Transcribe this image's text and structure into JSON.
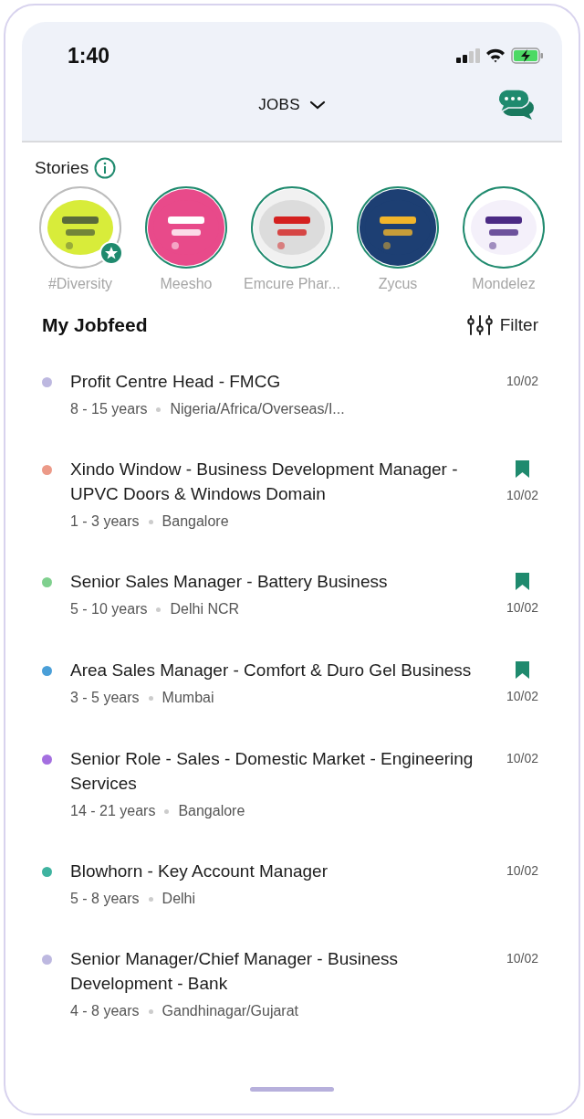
{
  "status_bar": {
    "time": "1:40"
  },
  "header": {
    "title": "JOBS"
  },
  "stories": {
    "title": "Stories",
    "items": [
      {
        "label": "#Diversity",
        "viewed": true,
        "featured": true
      },
      {
        "label": "Meesho",
        "viewed": false,
        "featured": false
      },
      {
        "label": "Emcure Phar...",
        "viewed": false,
        "featured": false
      },
      {
        "label": "Zycus",
        "viewed": false,
        "featured": false
      },
      {
        "label": "Mondelez",
        "viewed": false,
        "featured": false
      }
    ]
  },
  "jobfeed": {
    "title": "My Jobfeed",
    "filter": "Filter",
    "jobs": [
      {
        "title": "Profit Centre Head - FMCG",
        "experience": "8 - 15 years",
        "location": "Nigeria/Africa/Overseas/I...",
        "date": "10/02",
        "bookmarked": false,
        "color": "#bdb8e0"
      },
      {
        "title": "Xindo Window - Business Development Manager - UPVC Doors & Windows Domain",
        "experience": "1 - 3 years",
        "location": "Bangalore",
        "date": "10/02",
        "bookmarked": true,
        "color": "#ec9a88"
      },
      {
        "title": "Senior Sales Manager - Battery Business",
        "experience": "5 - 10 years",
        "location": "Delhi NCR",
        "date": "10/02",
        "bookmarked": true,
        "color": "#7fd08e"
      },
      {
        "title": "Area Sales Manager - Comfort & Duro Gel Business",
        "experience": "3 - 5 years",
        "location": "Mumbai",
        "date": "10/02",
        "bookmarked": true,
        "color": "#4a9fd8"
      },
      {
        "title": "Senior Role - Sales - Domestic Market - Engineering Services",
        "experience": "14 - 21 years",
        "location": "Bangalore",
        "date": "10/02",
        "bookmarked": false,
        "color": "#a46fe0"
      },
      {
        "title": "Blowhorn - Key Account Manager",
        "experience": "5 - 8 years",
        "location": "Delhi",
        "date": "10/02",
        "bookmarked": false,
        "color": "#3fb3a0"
      },
      {
        "title": "Senior Manager/Chief Manager - Business Development - Bank",
        "experience": "4 - 8 years",
        "location": "Gandhinagar/Gujarat",
        "date": "10/02",
        "bookmarked": false,
        "color": "#bdb8e0"
      }
    ]
  }
}
